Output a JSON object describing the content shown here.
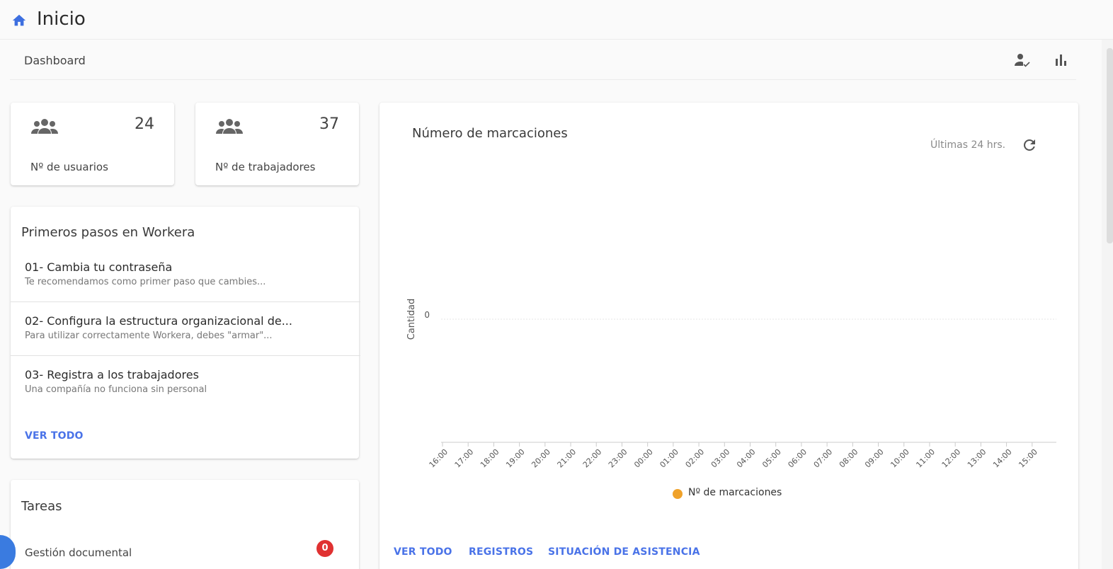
{
  "topbar": {
    "title": "Inicio",
    "icon": "home-icon"
  },
  "breadcrumb": {
    "label": "Dashboard"
  },
  "toolbar": {
    "icons": [
      "user-check-icon",
      "bar-chart-icon"
    ]
  },
  "stats": [
    {
      "value": "24",
      "label": "Nº de usuarios",
      "icon": "group-icon"
    },
    {
      "value": "37",
      "label": "Nº de trabajadores",
      "icon": "group-icon"
    }
  ],
  "steps_card": {
    "title": "Primeros pasos en Workera",
    "steps": [
      {
        "title": "01- Cambia tu contraseña",
        "desc": "Te recomendamos como primer paso que cambies..."
      },
      {
        "title": "02- Configura la estructura organizacional de...",
        "desc": "Para utilizar correctamente Workera, debes \"armar\"..."
      },
      {
        "title": "03- Registra a los trabajadores",
        "desc": "Una compañía no funciona sin personal"
      }
    ],
    "see_all": "VER TODO"
  },
  "tasks_card": {
    "title": "Tareas",
    "items": [
      {
        "label": "Gestión documental",
        "count": "0"
      }
    ]
  },
  "chart_card": {
    "title": "Número de marcaciones",
    "range_label": "Últimas 24 hrs.",
    "links": {
      "see_all": "VER TODO",
      "records": "REGISTROS",
      "attendance": "SITUACIÓN DE ASISTENCIA"
    }
  },
  "colors": {
    "accent": "#4a73e8",
    "badge": "#e03131",
    "series": "#f0a22a",
    "home": "#3d6fe0"
  },
  "chart_data": {
    "type": "line",
    "title": "",
    "ylabel": "Cantidad",
    "xlabel": "",
    "y_ticks": [
      "0"
    ],
    "x": [
      "16:00",
      "17:00",
      "18:00",
      "19:00",
      "20:00",
      "21:00",
      "22:00",
      "23:00",
      "00:00",
      "01:00",
      "02:00",
      "03:00",
      "04:00",
      "05:00",
      "06:00",
      "07:00",
      "08:00",
      "09:00",
      "10:00",
      "11:00",
      "12:00",
      "13:00",
      "14:00",
      "15:00"
    ],
    "series": [
      {
        "name": "Nº de marcaciones",
        "values": [
          0,
          0,
          0,
          0,
          0,
          0,
          0,
          0,
          0,
          0,
          0,
          0,
          0,
          0,
          0,
          0,
          0,
          0,
          0,
          0,
          0,
          0,
          0,
          0
        ]
      }
    ],
    "legend": "bottom",
    "grid": true
  }
}
